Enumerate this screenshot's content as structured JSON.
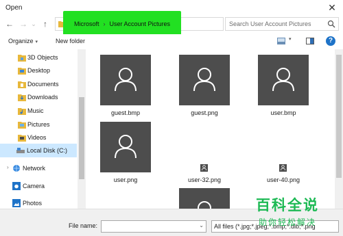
{
  "window": {
    "title": "Open"
  },
  "nav": {
    "back": "←",
    "forward": "→",
    "up": "↑",
    "recent_caret": "⌄",
    "refresh": "↻",
    "address_caret": "⌄"
  },
  "address": {
    "crumbs": [
      "Microsoft",
      "User Account Pictures"
    ],
    "separator": "›",
    "highlight_color": "#22e022"
  },
  "search": {
    "placeholder": "Search User Account Pictures"
  },
  "toolbar": {
    "organize": "Organize",
    "new_folder": "New folder",
    "caret": "▾",
    "help": "?"
  },
  "sidebar": {
    "items": [
      {
        "label": "3D Objects",
        "icon": "3d-objects-icon"
      },
      {
        "label": "Desktop",
        "icon": "desktop-folder-icon"
      },
      {
        "label": "Documents",
        "icon": "documents-folder-icon"
      },
      {
        "label": "Downloads",
        "icon": "downloads-folder-icon"
      },
      {
        "label": "Music",
        "icon": "music-folder-icon"
      },
      {
        "label": "Pictures",
        "icon": "pictures-folder-icon"
      },
      {
        "label": "Videos",
        "icon": "videos-folder-icon"
      },
      {
        "label": "Local Disk (C:)",
        "icon": "drive-icon",
        "selected": true
      },
      {
        "label": "Network",
        "icon": "network-icon"
      },
      {
        "label": "Camera",
        "icon": "camera-icon"
      },
      {
        "label": "Photos",
        "icon": "photos-icon"
      }
    ]
  },
  "files": [
    {
      "name": "guest.bmp",
      "kind": "large"
    },
    {
      "name": "guest.png",
      "kind": "large"
    },
    {
      "name": "user.bmp",
      "kind": "large"
    },
    {
      "name": "user.png",
      "kind": "large"
    },
    {
      "name": "user-32.png",
      "kind": "small"
    },
    {
      "name": "user-40.png",
      "kind": "small"
    },
    {
      "name": "",
      "kind": "large-partial"
    }
  ],
  "footer": {
    "file_name_label": "File name:",
    "file_name_value": "",
    "file_type": "All files (*.jpg;*.jpeg;*.bmp;*.dib;*.png"
  },
  "watermark": {
    "line1": "百科全说",
    "line2": "助你轻松解决",
    "color": "#1db954"
  },
  "colors": {
    "thumb_bg": "#4d4d4d",
    "selected_bg": "#cce8ff",
    "folder_yellow": "#e8b83c",
    "accent_blue": "#1e73c8"
  }
}
